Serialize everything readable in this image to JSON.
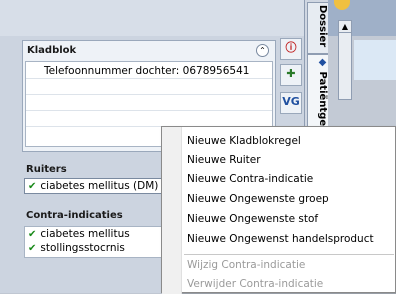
{
  "tabs": {
    "dossier": "Dossier",
    "patient": "Patiëntge"
  },
  "kladblok": {
    "title": "Kladblok",
    "collapse_icon": "chevron-up-icon",
    "note": "Telefoonnummer dochter: 0678956541"
  },
  "ruiters": {
    "title": "Ruiters",
    "items": [
      "ciabetes mellitus (DM)"
    ]
  },
  "contra": {
    "title": "Contra-indicaties",
    "items": [
      "ciabetes mellitus",
      "stollingsstocrnis"
    ]
  },
  "toolbar": {
    "vg_label": "VG"
  },
  "context_menu": {
    "items": [
      {
        "label": "Nieuwe Kladblokregel",
        "enabled": true
      },
      {
        "label": "Nieuwe Ruiter",
        "enabled": true
      },
      {
        "label": "Nieuwe Contra-indicatie",
        "enabled": true
      },
      {
        "label": "Nieuwe Ongewenste groep",
        "enabled": true
      },
      {
        "label": "Nieuwe Ongewenste stof",
        "enabled": true
      },
      {
        "label": "Nieuwe Ongewenst handelsproduct",
        "enabled": true
      },
      {
        "label": "Wijzig Contra-indicatie",
        "enabled": false
      },
      {
        "label": "Verwijder Contra-indicatie",
        "enabled": false
      }
    ]
  },
  "colors": {
    "check": "#1a8a1a",
    "disabled_text": "#9a9a9a"
  }
}
